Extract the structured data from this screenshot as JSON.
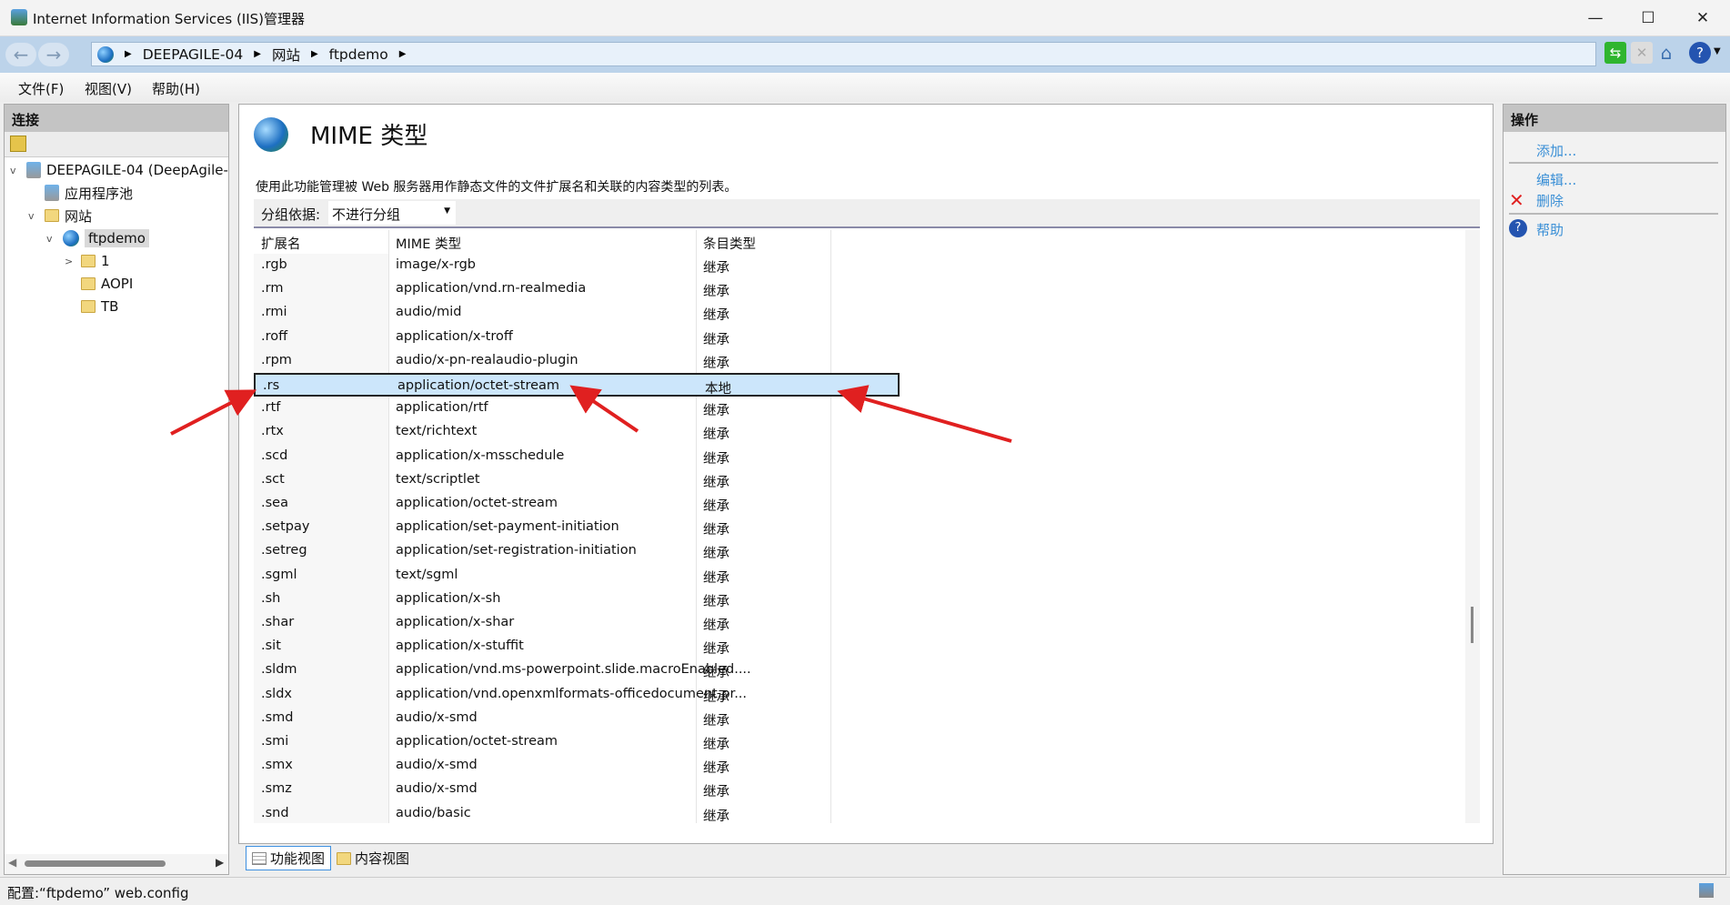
{
  "window": {
    "title": "Internet Information Services (IIS)管理器",
    "minimize": "—",
    "maximize": "☐",
    "close": "✕"
  },
  "address": {
    "crumbs": [
      "DEEPAGILE-04",
      "网站",
      "ftpdemo"
    ]
  },
  "menu": [
    "文件(F)",
    "视图(V)",
    "帮助(H)"
  ],
  "connections": {
    "title": "连接",
    "tree": [
      {
        "label": "DEEPAGILE-04 (DeepAgile-",
        "level": 0,
        "expand": "v",
        "icon": "server-icon"
      },
      {
        "label": "应用程序池",
        "level": 1,
        "expand": "",
        "icon": "app-pool-icon"
      },
      {
        "label": "网站",
        "level": 1,
        "expand": "v",
        "icon": "sites-folder-icon"
      },
      {
        "label": "ftpdemo",
        "level": 2,
        "expand": "v",
        "icon": "globe-icon",
        "selected": true
      },
      {
        "label": "1",
        "level": 3,
        "expand": ">",
        "icon": "folder-icon"
      },
      {
        "label": "AOPI",
        "level": 3,
        "expand": "",
        "icon": "folder-icon"
      },
      {
        "label": "TB",
        "level": 3,
        "expand": "",
        "icon": "folder-icon"
      }
    ]
  },
  "main": {
    "title": "MIME 类型",
    "description": "使用此功能管理被 Web 服务器用作静态文件的文件扩展名和关联的内容类型的列表。",
    "group_label": "分组依据:",
    "group_value": "不进行分组",
    "columns": [
      "扩展名",
      "MIME 类型",
      "条目类型"
    ],
    "rows": [
      [
        ".rgb",
        "image/x-rgb",
        "继承"
      ],
      [
        ".rm",
        "application/vnd.rn-realmedia",
        "继承"
      ],
      [
        ".rmi",
        "audio/mid",
        "继承"
      ],
      [
        ".roff",
        "application/x-troff",
        "继承"
      ],
      [
        ".rpm",
        "audio/x-pn-realaudio-plugin",
        "继承"
      ],
      [
        ".rs",
        "application/octet-stream",
        "本地"
      ],
      [
        ".rtf",
        "application/rtf",
        "继承"
      ],
      [
        ".rtx",
        "text/richtext",
        "继承"
      ],
      [
        ".scd",
        "application/x-msschedule",
        "继承"
      ],
      [
        ".sct",
        "text/scriptlet",
        "继承"
      ],
      [
        ".sea",
        "application/octet-stream",
        "继承"
      ],
      [
        ".setpay",
        "application/set-payment-initiation",
        "继承"
      ],
      [
        ".setreg",
        "application/set-registration-initiation",
        "继承"
      ],
      [
        ".sgml",
        "text/sgml",
        "继承"
      ],
      [
        ".sh",
        "application/x-sh",
        "继承"
      ],
      [
        ".shar",
        "application/x-shar",
        "继承"
      ],
      [
        ".sit",
        "application/x-stuffit",
        "继承"
      ],
      [
        ".sldm",
        "application/vnd.ms-powerpoint.slide.macroEnabled....",
        "继承"
      ],
      [
        ".sldx",
        "application/vnd.openxmlformats-officedocument.pr...",
        "继承"
      ],
      [
        ".smd",
        "audio/x-smd",
        "继承"
      ],
      [
        ".smi",
        "application/octet-stream",
        "继承"
      ],
      [
        ".smx",
        "audio/x-smd",
        "继承"
      ],
      [
        ".smz",
        "audio/x-smd",
        "继承"
      ],
      [
        ".snd",
        "audio/basic",
        "继承"
      ]
    ],
    "selected_row": 5,
    "tabs": [
      "功能视图",
      "内容视图"
    ]
  },
  "actions": {
    "title": "操作",
    "add": "添加...",
    "edit": "编辑...",
    "delete": "删除",
    "help": "帮助"
  },
  "status": "配置:“ftpdemo” web.config",
  "colors": {
    "selection": "#cce6fb",
    "link": "#3a8fd6",
    "annotation_arrow": "#e02020"
  }
}
